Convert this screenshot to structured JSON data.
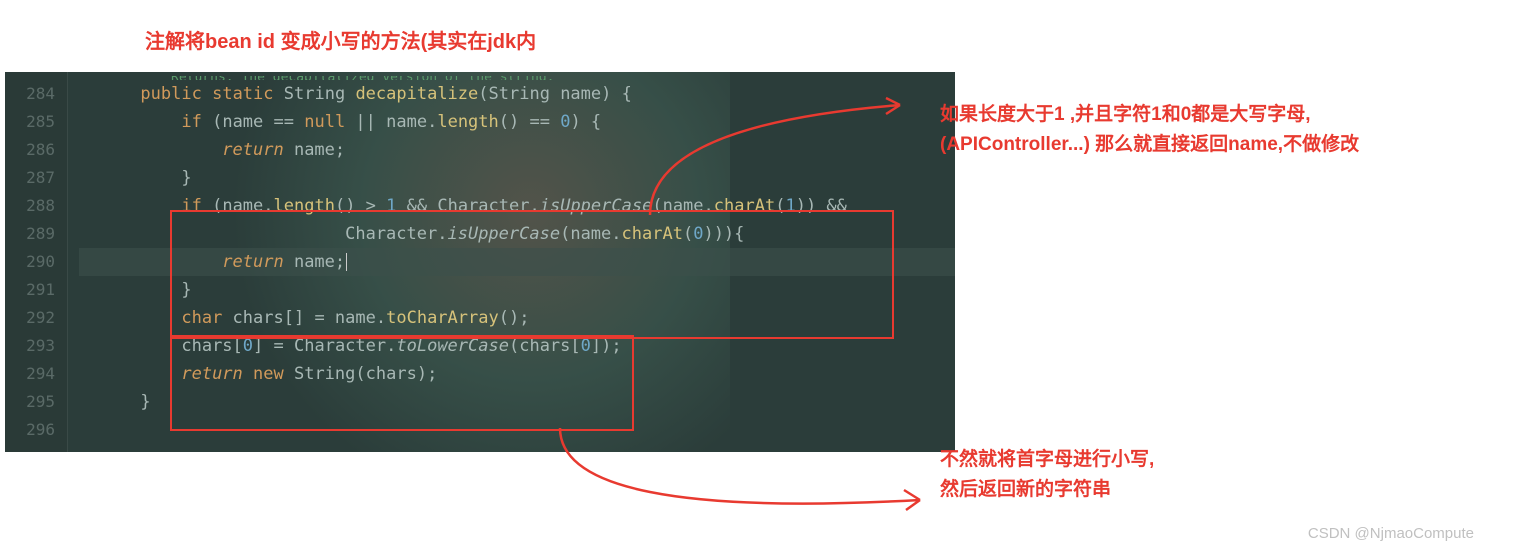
{
  "title": "注解将bean id 变成小写的方法(其实在jdk内",
  "annotation1_line1": "如果长度大于1 ,并且字符1和0都是大写字母,",
  "annotation1_line2": "(APIController...) 那么就直接返回name,不做修改",
  "annotation2_line1": "不然就将首字母进行小写,",
  "annotation2_line2": "然后返回新的字符串",
  "watermark": "CSDN @NjmaoCompute",
  "doc_comment": "Returns: The decapitalized version of the string.",
  "line_numbers": [
    "284",
    "285",
    "286",
    "287",
    "288",
    "289",
    "290",
    "291",
    "292",
    "293",
    "294",
    "295",
    "296"
  ],
  "code": {
    "l284_kw1": "public",
    "l284_kw2": "static",
    "l284_type": "String",
    "l284_fn": "decapitalize",
    "l284_p1": "(",
    "l284_pt": "String",
    "l284_pn": "name",
    "l284_p2": ") {",
    "l285_kw": "if ",
    "l285_p1": "(",
    "l285_v1": "name",
    "l285_op1": " == ",
    "l285_null": "null",
    "l285_or": " || ",
    "l285_v2": "name",
    "l285_dot1": ".",
    "l285_m1": "length",
    "l285_call1": "()",
    "l285_eq": " == ",
    "l285_num": "0",
    "l285_p2": ") {",
    "l286_kw": "return ",
    "l286_v": "name",
    "l286_s": ";",
    "l287_b": "}",
    "l288_kw": "if ",
    "l288_p1": "(",
    "l288_v1": "name",
    "l288_d1": ".",
    "l288_m1": "length",
    "l288_c1": "()",
    "l288_gt": " > ",
    "l288_n1": "1",
    "l288_and": " && ",
    "l288_cls": "Character",
    "l288_d2": ".",
    "l288_m2": "isUpperCase",
    "l288_p2": "(",
    "l288_v2": "name",
    "l288_d3": ".",
    "l288_m3": "charAt",
    "l288_p3": "(",
    "l288_n2": "1",
    "l288_p4": "))",
    "l288_and2": " &&",
    "l289_cls": "Character",
    "l289_d1": ".",
    "l289_m1": "isUpperCase",
    "l289_p1": "(",
    "l289_v1": "name",
    "l289_d2": ".",
    "l289_m2": "charAt",
    "l289_p2": "(",
    "l289_n1": "0",
    "l289_p3": "))){",
    "l290_kw": "return ",
    "l290_v": "name",
    "l290_s": ";",
    "l291_b": "}",
    "l292_t": "char ",
    "l292_v": "chars",
    "l292_br": "[] = ",
    "l292_v2": "name",
    "l292_d": ".",
    "l292_m": "toCharArray",
    "l292_c": "();",
    "l293_v1": "chars",
    "l293_p1": "[",
    "l293_n": "0",
    "l293_p2": "] = ",
    "l293_cls": "Character",
    "l293_d": ".",
    "l293_m": "toLowerCase",
    "l293_p3": "(",
    "l293_v2": "chars",
    "l293_p4": "[",
    "l293_n2": "0",
    "l293_p5": "]);",
    "l294_kw": "return ",
    "l294_new": "new ",
    "l294_t": "String",
    "l294_p": "(",
    "l294_v": "chars",
    "l294_p2": ");",
    "l295_b": "}"
  }
}
